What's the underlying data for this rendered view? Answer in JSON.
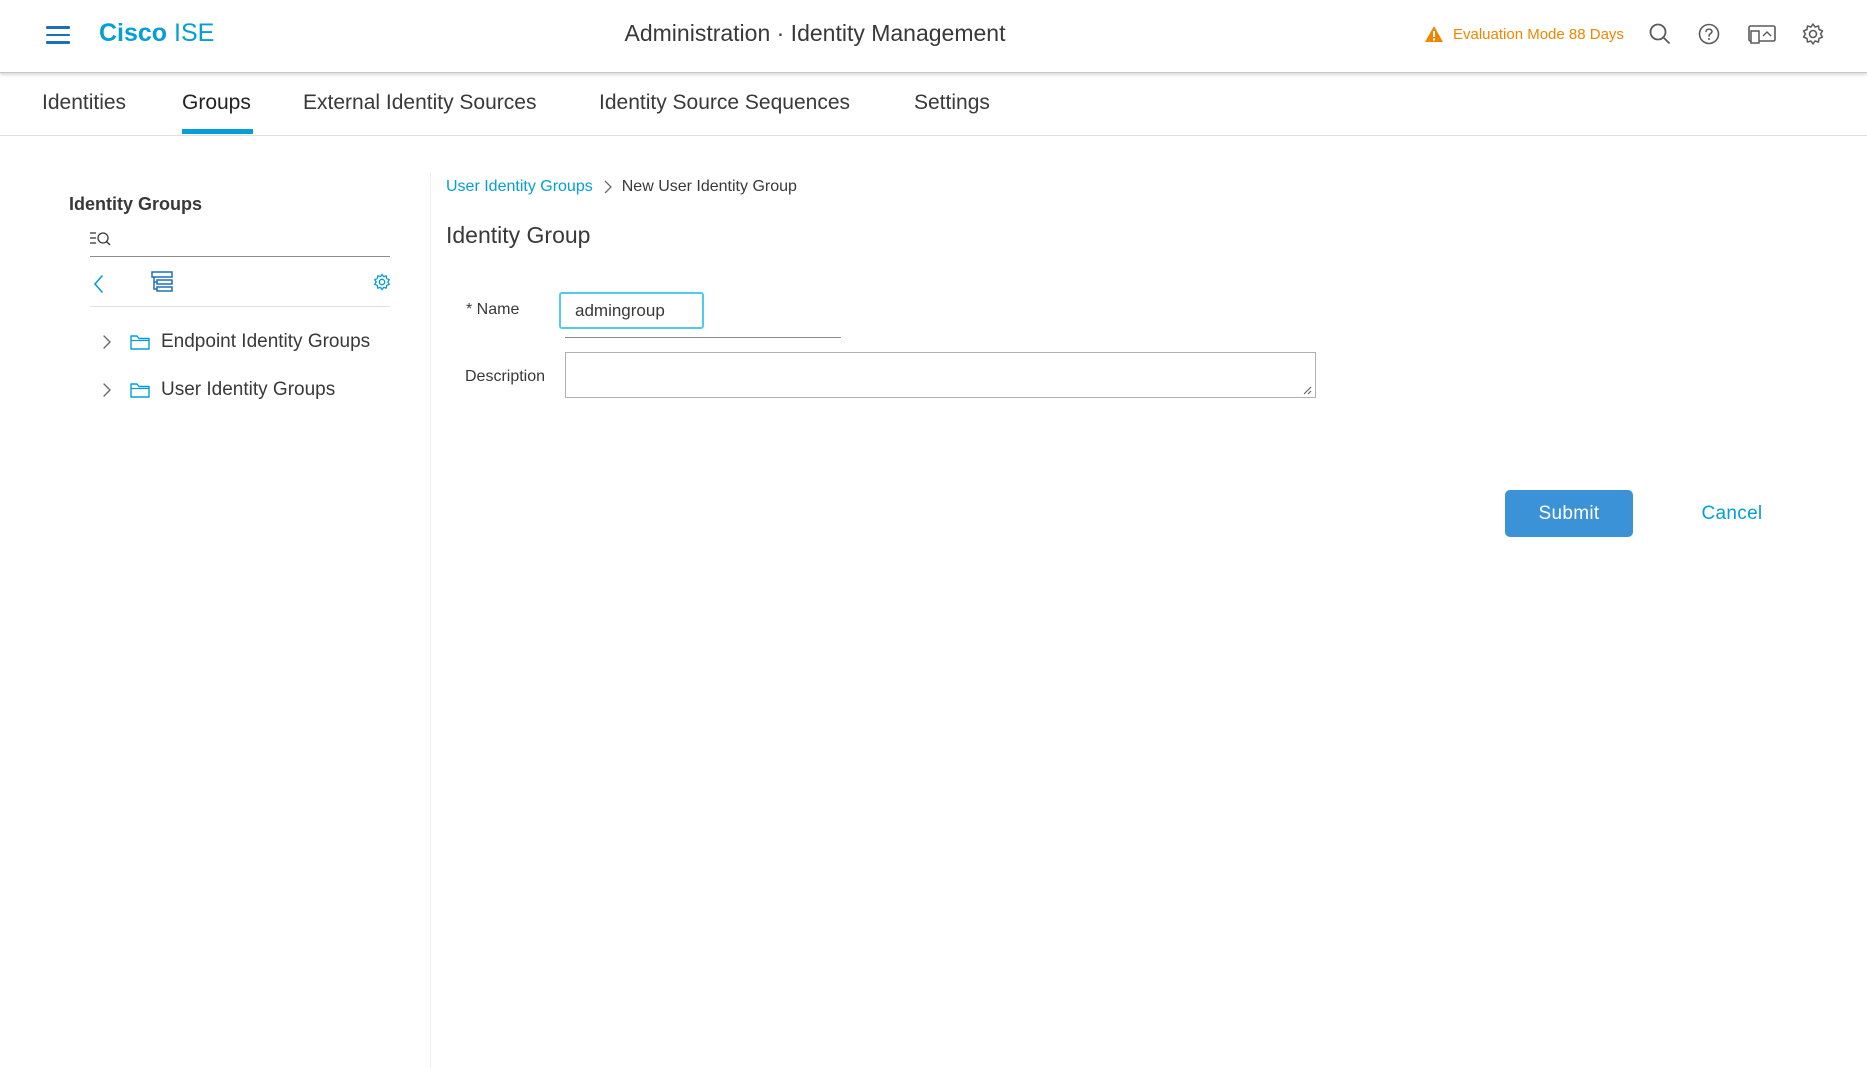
{
  "header": {
    "brand_bold": "Cisco",
    "brand_light": "ISE",
    "title": "Administration · Identity Management",
    "evaluation_notice": "Evaluation Mode 88 Days",
    "icons": [
      "menu-icon",
      "warning-icon",
      "search-icon",
      "help-icon",
      "monitor-icon",
      "gear-icon"
    ],
    "warning_color": "#ee8700",
    "accent_color": "#049fd9"
  },
  "tabs": [
    {
      "label": "Identities",
      "active": false
    },
    {
      "label": "Groups",
      "active": true
    },
    {
      "label": "External Identity Sources",
      "active": false
    },
    {
      "label": "Identity Source Sequences",
      "active": false
    },
    {
      "label": "Settings",
      "active": false
    }
  ],
  "sidebar": {
    "title": "Identity Groups",
    "search_placeholder": "",
    "toolbar_icons": [
      "back-icon",
      "tree-view-icon",
      "gear-icon"
    ],
    "items": [
      {
        "label": "Endpoint Identity Groups",
        "icon": "folder-icon"
      },
      {
        "label": "User Identity Groups",
        "icon": "folder-icon"
      }
    ]
  },
  "breadcrumb": {
    "parent": "User Identity Groups",
    "current": "New User Identity Group"
  },
  "form": {
    "section_title": "Identity Group",
    "name_label": "* Name",
    "name_value": "admingroup",
    "description_label": "Description",
    "description_value": ""
  },
  "actions": {
    "submit_label": "Submit",
    "cancel_label": "Cancel",
    "submit_color": "#3b92d6"
  }
}
